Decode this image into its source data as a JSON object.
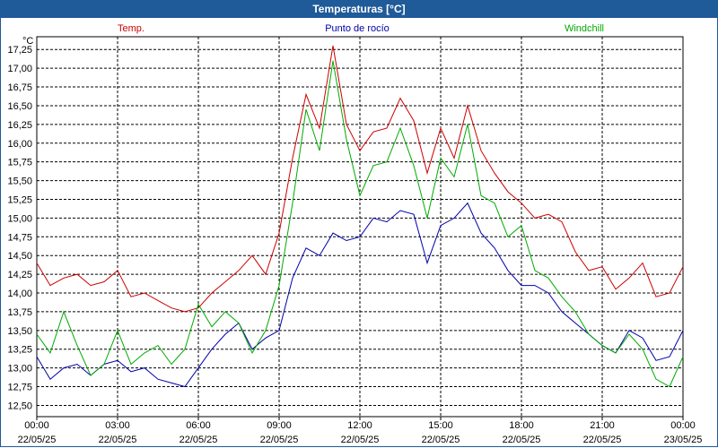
{
  "window": {
    "title": "Temperaturas [°C]"
  },
  "colors": {
    "temp": "#cc0000",
    "dew": "#0000aa",
    "windchill": "#00aa00",
    "titlebar": "#1f5a99"
  },
  "chart_data": {
    "type": "line",
    "title": "Temperaturas [°C]",
    "ylabel": "°C",
    "ylim": [
      12.35,
      17.42
    ],
    "yticks": [
      "12,50",
      "12,75",
      "13,00",
      "13,25",
      "13,50",
      "13,75",
      "14,00",
      "14,25",
      "14,50",
      "14,75",
      "15,00",
      "15,25",
      "15,50",
      "15,75",
      "16,00",
      "16,25",
      "16,50",
      "16,75",
      "17,00",
      "17,25"
    ],
    "xticks": [
      {
        "time": "00:00",
        "date": "22/05/25"
      },
      {
        "time": "03:00",
        "date": "22/05/25"
      },
      {
        "time": "06:00",
        "date": "22/05/25"
      },
      {
        "time": "09:00",
        "date": "22/05/25"
      },
      {
        "time": "12:00",
        "date": "22/05/25"
      },
      {
        "time": "15:00",
        "date": "22/05/25"
      },
      {
        "time": "18:00",
        "date": "22/05/25"
      },
      {
        "time": "21:00",
        "date": "22/05/25"
      },
      {
        "time": "00:00",
        "date": "23/05/25"
      }
    ],
    "x_hours": [
      0,
      0.5,
      1,
      1.5,
      2,
      2.5,
      3,
      3.5,
      4,
      4.5,
      5,
      5.5,
      6,
      6.5,
      7,
      7.5,
      8,
      8.5,
      9,
      9.5,
      10,
      10.5,
      11,
      11.5,
      12,
      12.5,
      13,
      13.5,
      14,
      14.5,
      15,
      15.5,
      16,
      16.5,
      17,
      17.5,
      18,
      18.5,
      19,
      19.5,
      20,
      20.5,
      21,
      21.5,
      22,
      22.5,
      23,
      23.5,
      24
    ],
    "grid": true,
    "series": [
      {
        "name": "Temp.",
        "values": [
          14.4,
          14.1,
          14.2,
          14.25,
          14.1,
          14.15,
          14.3,
          13.95,
          14.0,
          13.9,
          13.8,
          13.75,
          13.8,
          14.0,
          14.15,
          14.3,
          14.5,
          14.25,
          14.8,
          15.8,
          16.65,
          16.2,
          17.3,
          16.25,
          15.9,
          16.15,
          16.2,
          16.6,
          16.3,
          15.6,
          16.2,
          15.8,
          16.5,
          15.9,
          15.6,
          15.35,
          15.2,
          15.0,
          15.05,
          14.95,
          14.55,
          14.3,
          14.35,
          14.05,
          14.2,
          14.4,
          13.95,
          14.0,
          14.35
        ]
      },
      {
        "name": "Punto de rocío",
        "values": [
          13.15,
          12.85,
          13.0,
          13.05,
          12.9,
          13.05,
          13.1,
          12.95,
          13.0,
          12.85,
          12.8,
          12.75,
          13.0,
          13.25,
          13.45,
          13.6,
          13.25,
          13.4,
          13.5,
          14.2,
          14.6,
          14.5,
          14.8,
          14.7,
          14.75,
          15.0,
          14.95,
          15.1,
          15.05,
          14.4,
          14.9,
          15.0,
          15.2,
          14.8,
          14.6,
          14.3,
          14.1,
          14.1,
          14.0,
          13.75,
          13.6,
          13.45,
          13.3,
          13.2,
          13.5,
          13.4,
          13.1,
          13.15,
          13.5
        ]
      },
      {
        "name": "Windchill",
        "values": [
          13.45,
          13.2,
          13.75,
          13.3,
          12.9,
          13.05,
          13.5,
          13.05,
          13.2,
          13.3,
          13.05,
          13.25,
          13.85,
          13.55,
          13.75,
          13.6,
          13.2,
          13.5,
          14.1,
          15.2,
          16.45,
          15.9,
          17.1,
          16.05,
          15.3,
          15.7,
          15.75,
          16.2,
          15.7,
          15.0,
          15.8,
          15.55,
          16.25,
          15.3,
          15.2,
          14.75,
          14.9,
          14.3,
          14.2,
          13.95,
          13.75,
          13.45,
          13.3,
          13.2,
          13.45,
          13.25,
          12.85,
          12.75,
          13.15
        ]
      }
    ]
  }
}
